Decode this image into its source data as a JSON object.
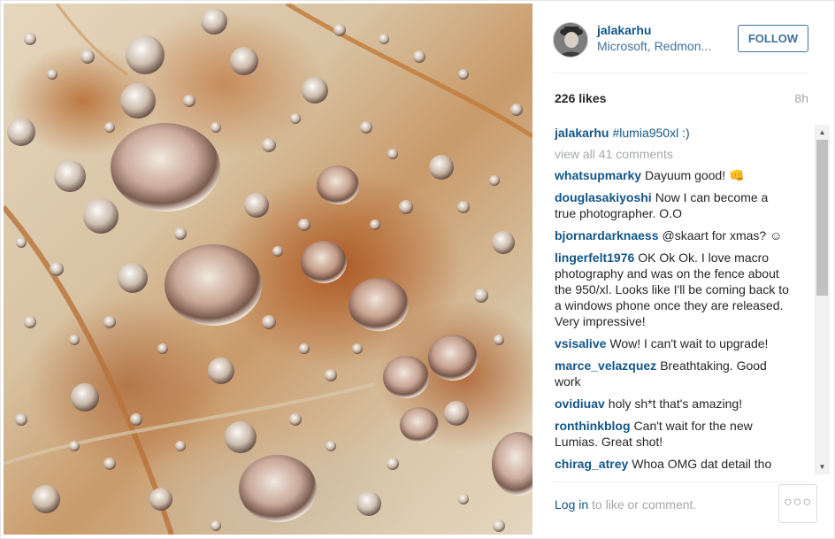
{
  "photo": {
    "description_icon": "macro-photo-water-droplets-on-leaf"
  },
  "header": {
    "username": "jalakarhu",
    "location": "Microsoft, Redmon...",
    "follow_label": "FOLLOW"
  },
  "stats": {
    "likes": "226 likes",
    "time": "8h"
  },
  "caption": {
    "user": "jalakarhu",
    "text": "#lumia950xl :)"
  },
  "view_all": "view all 41 comments",
  "comments": [
    {
      "user": "whatsupmarky",
      "text": "Dayuum good! 👊"
    },
    {
      "user": "douglasakiyoshi",
      "text": "Now I can become a true photographer. O.O"
    },
    {
      "user": "bjornardarknaess",
      "text": "@skaart for xmas? ☺"
    },
    {
      "user": "lingerfelt1976",
      "text": "OK Ok Ok. I love macro photography and was on the fence about the 950/xl. Looks like I'll be coming back to a windows phone once they are released. Very impressive!"
    },
    {
      "user": "vsisalive",
      "text": "Wow! I can't wait to upgrade!"
    },
    {
      "user": "marce_velazquez",
      "text": "Breathtaking. Good work"
    },
    {
      "user": "ovidiuav",
      "text": "holy sh*t that's amazing!"
    },
    {
      "user": "ronthinkblog",
      "text": "Can't wait for the new Lumias. Great shot!"
    },
    {
      "user": "chirag_atrey",
      "text": "Whoa OMG dat detail tho"
    }
  ],
  "footer": {
    "login_link": "Log in",
    "login_rest": " to like or comment.",
    "more_label": "○○○"
  },
  "colors": {
    "link": "#125688",
    "accent": "#3f729b",
    "muted": "#a5a7aa"
  }
}
